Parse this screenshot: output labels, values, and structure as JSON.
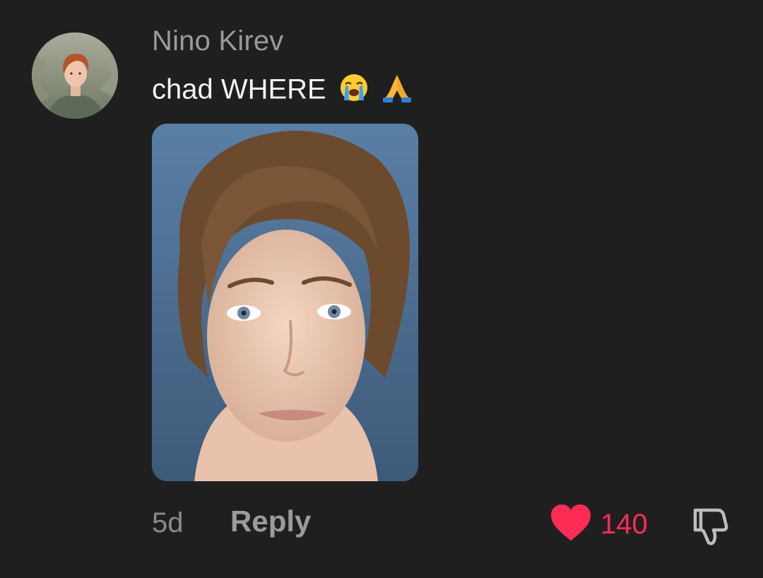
{
  "comment": {
    "author": "Nino Kirev",
    "text": "chad WHERE",
    "emojis": [
      "loudly-crying-face-emoji",
      "folded-hands-emoji"
    ],
    "attachment": "photo",
    "time_ago": "5d",
    "reply_label": "Reply",
    "like_count": "140",
    "liked": true
  },
  "colors": {
    "background": "#1f1f20",
    "author": "#9a9a9a",
    "text": "#f2f2f2",
    "like_accent": "#fe2c55",
    "muted": "#8a8a8a"
  },
  "icons": {
    "like": "heart-icon",
    "dislike": "thumbs-down-icon"
  }
}
